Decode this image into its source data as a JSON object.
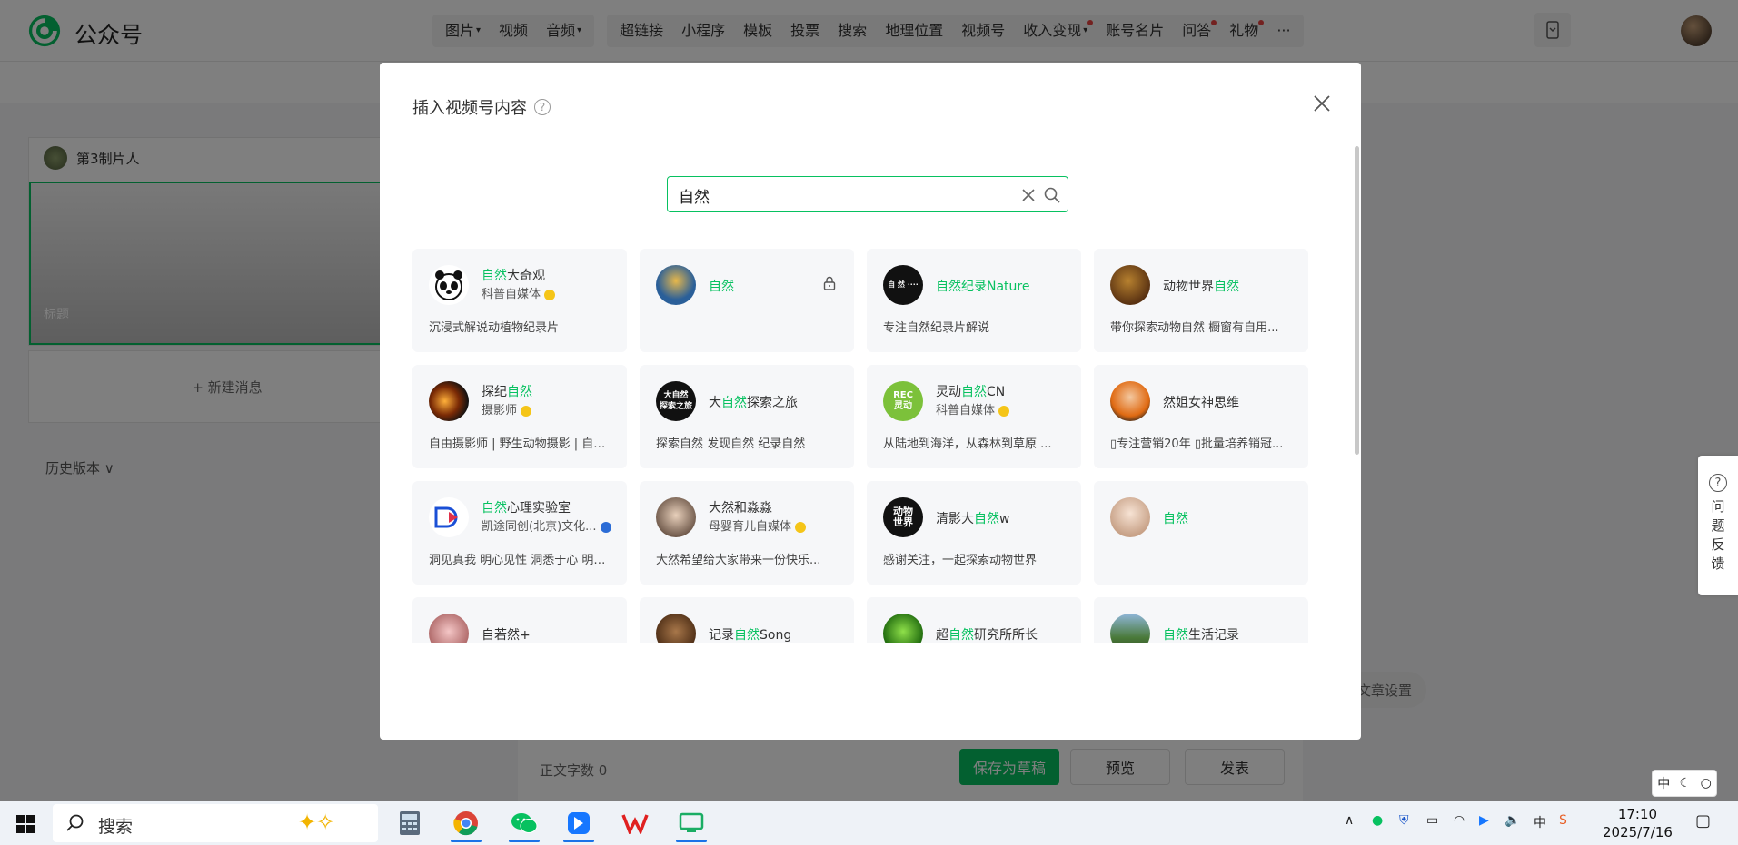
{
  "app": {
    "title": "公众号"
  },
  "toolbar": {
    "group1": [
      {
        "label": "图片",
        "caret": true
      },
      {
        "label": "视频",
        "caret": false
      },
      {
        "label": "音频",
        "caret": true
      }
    ],
    "group2": [
      {
        "label": "超链接",
        "dot": false,
        "caret": false
      },
      {
        "label": "小程序",
        "dot": false,
        "caret": false
      },
      {
        "label": "模板",
        "dot": false,
        "caret": false
      },
      {
        "label": "投票",
        "dot": false,
        "caret": false
      },
      {
        "label": "搜索",
        "dot": false,
        "caret": false
      },
      {
        "label": "地理位置",
        "dot": false,
        "caret": false
      },
      {
        "label": "视频号",
        "dot": false,
        "caret": false
      },
      {
        "label": "收入变现",
        "dot": true,
        "caret": true
      },
      {
        "label": "账号名片",
        "dot": false,
        "caret": false
      },
      {
        "label": "问答",
        "dot": true,
        "caret": false
      },
      {
        "label": "礼物",
        "dot": true,
        "caret": false
      },
      {
        "label": "···",
        "dot": false,
        "caret": false
      }
    ]
  },
  "sidebar": {
    "account": "第3制片人",
    "thumb_title": "标题",
    "new_message": "+ 新建消息",
    "history": "历史版本 ∨"
  },
  "editor": {
    "word_count": "正文字数 0",
    "save_draft": "保存为草稿",
    "preview": "预览",
    "publish": "发表",
    "article_settings": "文章设置"
  },
  "modal": {
    "title": "插入视频号内容",
    "search_value": "自然",
    "results": [
      {
        "pre": "",
        "hl": "自然",
        "post": "大奇观",
        "sub": "科普自媒体",
        "badge": "gold",
        "desc": "沉浸式解说动植物纪录片",
        "avatar": "panda"
      },
      {
        "pre": "",
        "hl": "自然",
        "post": "",
        "sub": "",
        "badge": "",
        "desc": "",
        "avatar": "blue",
        "lock": true
      },
      {
        "pre": "",
        "hl": "自然",
        "post": "纪录Nature",
        "sub": "",
        "badge": "",
        "desc": "专注自然纪录片解说",
        "avatar": "black",
        "all_hl": true
      },
      {
        "pre": "动物世界",
        "hl": "自然",
        "post": "",
        "sub": "",
        "badge": "",
        "desc": "带你探索动物自然 橱窗有自用...",
        "avatar": "brown"
      },
      {
        "pre": "探纪",
        "hl": "自然",
        "post": "",
        "sub": "摄影师",
        "badge": "gold",
        "desc": "自由摄影师 | 野生动物摄影 | 自然...",
        "avatar": "orange"
      },
      {
        "pre": "大",
        "hl": "自然",
        "post": "探索之旅",
        "sub": "",
        "badge": "",
        "desc": "探索自然 发现自然 纪录自然",
        "avatar": "dark-text"
      },
      {
        "pre": "灵动",
        "hl": "自然",
        "post": "CN",
        "sub": "科普自媒体",
        "badge": "gold",
        "desc": "从陆地到海洋，从森林到草原 ...",
        "avatar": "green-rec"
      },
      {
        "pre": "然姐女神思维",
        "hl": "",
        "post": "",
        "sub": "",
        "badge": "",
        "desc": "▯专注营销20年 ▯批量培养销冠...",
        "avatar": "person"
      },
      {
        "pre": "",
        "hl": "自然",
        "post": "心理实验室",
        "sub": "凯途同创(北京)文化...",
        "badge": "blue",
        "desc": "洞见真我 明心见性 洞悉于心 明见...",
        "avatar": "logo-d"
      },
      {
        "pre": "大然和淼淼",
        "hl": "",
        "post": "",
        "sub": "母婴育儿自媒体",
        "badge": "gold",
        "desc": "大然希望给大家带来一份快乐...",
        "avatar": "kids"
      },
      {
        "pre": "清影大",
        "hl": "自然",
        "post": "w",
        "sub": "",
        "badge": "",
        "desc": "感谢关注，一起探索动物世界",
        "avatar": "animal-world"
      },
      {
        "pre": "",
        "hl": "自然",
        "post": "",
        "sub": "",
        "badge": "",
        "desc": "",
        "avatar": "girl"
      },
      {
        "pre": "自若然+",
        "hl": "",
        "post": "",
        "sub": "",
        "badge": "",
        "desc": "",
        "avatar": "pink"
      },
      {
        "pre": "记录",
        "hl": "自然",
        "post": "Song",
        "sub": "",
        "badge": "",
        "desc": "",
        "avatar": "rust"
      },
      {
        "pre": "超",
        "hl": "自然",
        "post": "研究所所长",
        "sub": "",
        "badge": "",
        "desc": "",
        "avatar": "green-moss"
      },
      {
        "pre": "",
        "hl": "自然",
        "post": "生活记录",
        "sub": "",
        "badge": "",
        "desc": "",
        "avatar": "landscape"
      }
    ]
  },
  "feedback": {
    "label": "问题反馈"
  },
  "ime": {
    "label": "中"
  },
  "taskbar": {
    "search": "搜索",
    "time": "17:10",
    "date": "2025/7/16",
    "ime": "中"
  },
  "colors": {
    "accent": "#07c160",
    "badge_gold": "#f5c518",
    "dot": "#e64340"
  }
}
